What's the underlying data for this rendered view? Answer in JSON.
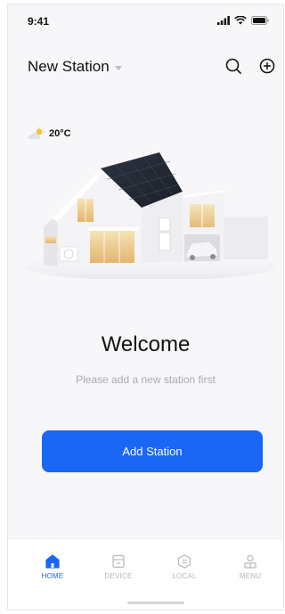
{
  "status_bar": {
    "time": "9:41",
    "icons": [
      "signal-icon",
      "wifi-icon",
      "battery-icon"
    ]
  },
  "header": {
    "station_name": "New Station",
    "actions": [
      "search-icon",
      "add-circle-icon"
    ]
  },
  "weather": {
    "icon": "partly-cloudy-icon",
    "temperature": "20°C"
  },
  "hero": {
    "illustration": "house-with-solar-panels"
  },
  "main": {
    "welcome_title": "Welcome",
    "subtitle": "Please add a new station first",
    "add_station_label": "Add Station"
  },
  "tabbar": {
    "tabs": [
      {
        "label": "HOME",
        "icon": "home-icon",
        "active": true
      },
      {
        "label": "DEVICE",
        "icon": "device-icon",
        "active": false
      },
      {
        "label": "LOCAL",
        "icon": "local-icon",
        "active": false
      },
      {
        "label": "MENU",
        "icon": "menu-icon",
        "active": false
      }
    ]
  },
  "colors": {
    "accent": "#1a66f5",
    "inactive_tab": "#b6b6bc",
    "subtitle": "#a9a9b0"
  }
}
